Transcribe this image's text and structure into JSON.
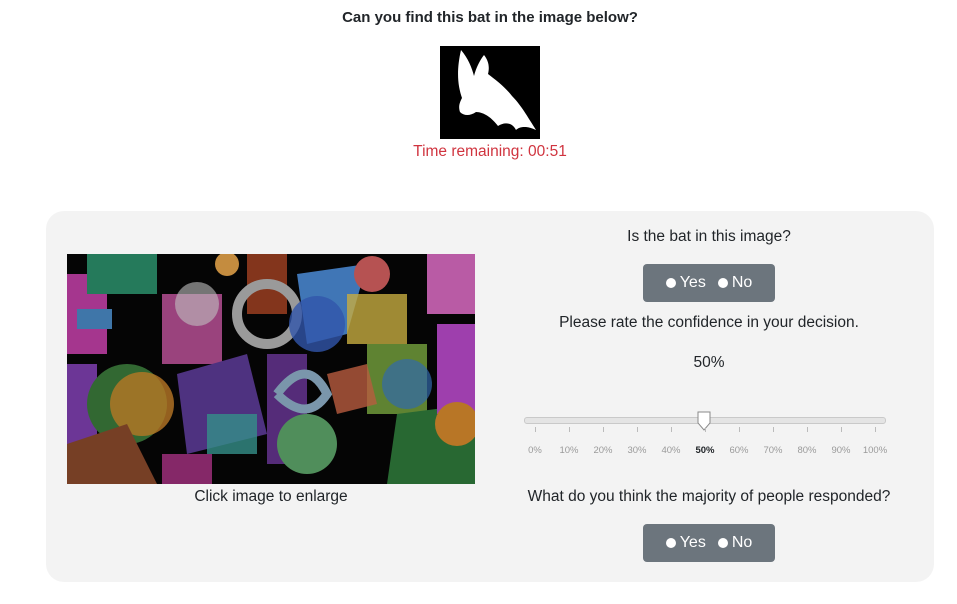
{
  "question": {
    "title": "Can you find this bat in the image below?",
    "target_icon": "bat-silhouette",
    "timer_text": "Time remaining: 00:51"
  },
  "stimulus": {
    "caption": "Click image to enlarge"
  },
  "q1": {
    "prompt": "Is the bat in this image?",
    "options": [
      "Yes",
      "No"
    ]
  },
  "confidence": {
    "prompt": "Please rate the confidence in your decision.",
    "value_text": "50%",
    "value": 50,
    "ticks": [
      "0%",
      "10%",
      "20%",
      "30%",
      "40%",
      "50%",
      "60%",
      "70%",
      "80%",
      "90%",
      "100%"
    ]
  },
  "q2": {
    "prompt": "What do you think the majority of people responded?",
    "options": [
      "Yes",
      "No"
    ]
  },
  "colors": {
    "timer": "#d0343f",
    "button_group": "#6c757d",
    "panel_bg": "#f3f3f3"
  }
}
